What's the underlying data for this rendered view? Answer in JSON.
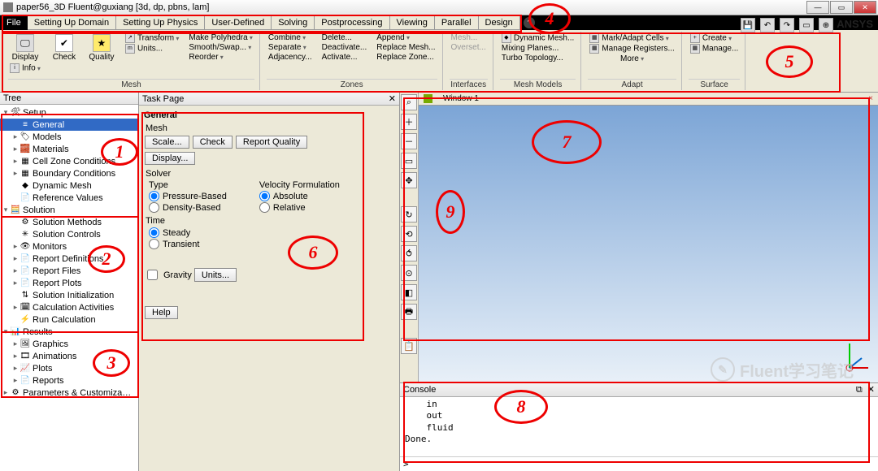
{
  "title": "paper56_3D Fluent@guxiang [3d, dp, pbns, lam]",
  "menus": [
    "File",
    "Setting Up Domain",
    "Setting Up Physics",
    "User-Defined",
    "Solving",
    "Postprocessing",
    "Viewing",
    "Parallel",
    "Design"
  ],
  "ansys": "ANSYS",
  "ribbon": {
    "mesh": {
      "label": "Mesh",
      "display": "Display",
      "info": "Info",
      "check": "Check",
      "quality": "Quality",
      "transform": "Transform",
      "units": "Units...",
      "col": [
        "Make Polyhedra",
        "Smooth/Swap...",
        "Reorder"
      ]
    },
    "zones": {
      "label": "Zones",
      "c1": [
        "Combine",
        "Separate",
        "Adjacency..."
      ],
      "c2": [
        "Delete...",
        "Deactivate...",
        "Activate..."
      ],
      "c3": [
        "Append",
        "Replace Mesh...",
        "Replace Zone..."
      ]
    },
    "interfaces": {
      "label": "Interfaces",
      "a": "Mesh...",
      "b": "Overset..."
    },
    "meshmodels": {
      "label": "Mesh Models",
      "items": [
        "Dynamic Mesh...",
        "Mixing Planes...",
        "Turbo Topology..."
      ]
    },
    "adapt": {
      "label": "Adapt",
      "a": "Mark/Adapt Cells",
      "b": "Manage Registers...",
      "c": "More"
    },
    "surface": {
      "label": "Surface",
      "a": "Create",
      "b": "Manage..."
    }
  },
  "tree": {
    "header": "Tree",
    "setup": {
      "label": "Setup",
      "items": [
        "General",
        "Models",
        "Materials",
        "Cell Zone Conditions",
        "Boundary Conditions",
        "Dynamic Mesh",
        "Reference Values"
      ]
    },
    "solution": {
      "label": "Solution",
      "items": [
        "Solution Methods",
        "Solution Controls",
        "Monitors",
        "Report Definitions",
        "Report Files",
        "Report Plots",
        "Solution Initialization",
        "Calculation Activities",
        "Run Calculation"
      ]
    },
    "results": {
      "label": "Results",
      "items": [
        "Graphics",
        "Animations",
        "Plots",
        "Reports"
      ]
    },
    "params": "Parameters & Customiza…"
  },
  "task": {
    "header": "Task Page",
    "title": "General",
    "mesh": "Mesh",
    "scale": "Scale",
    "check": "Check",
    "rq": "Report Quality",
    "display": "Display",
    "solver": "Solver",
    "type": "Type",
    "vf": "Velocity Formulation",
    "pb": "Pressure-Based",
    "db": "Density-Based",
    "abs": "Absolute",
    "rel": "Relative",
    "time": "Time",
    "steady": "Steady",
    "transient": "Transient",
    "gravity": "Gravity",
    "units": "Units",
    "help": "Help"
  },
  "gfx": {
    "tab": "Window 1"
  },
  "console": {
    "header": "Console",
    "body": "    in\n    out\n    fluid\nDone.\n\n>",
    "prompt": ">"
  },
  "wm": "Fluent学习笔记",
  "nums": {
    "1": "1",
    "2": "2",
    "3": "3",
    "4": "4",
    "5": "5",
    "6": "6",
    "7": "7",
    "8": "8",
    "9": "9"
  }
}
